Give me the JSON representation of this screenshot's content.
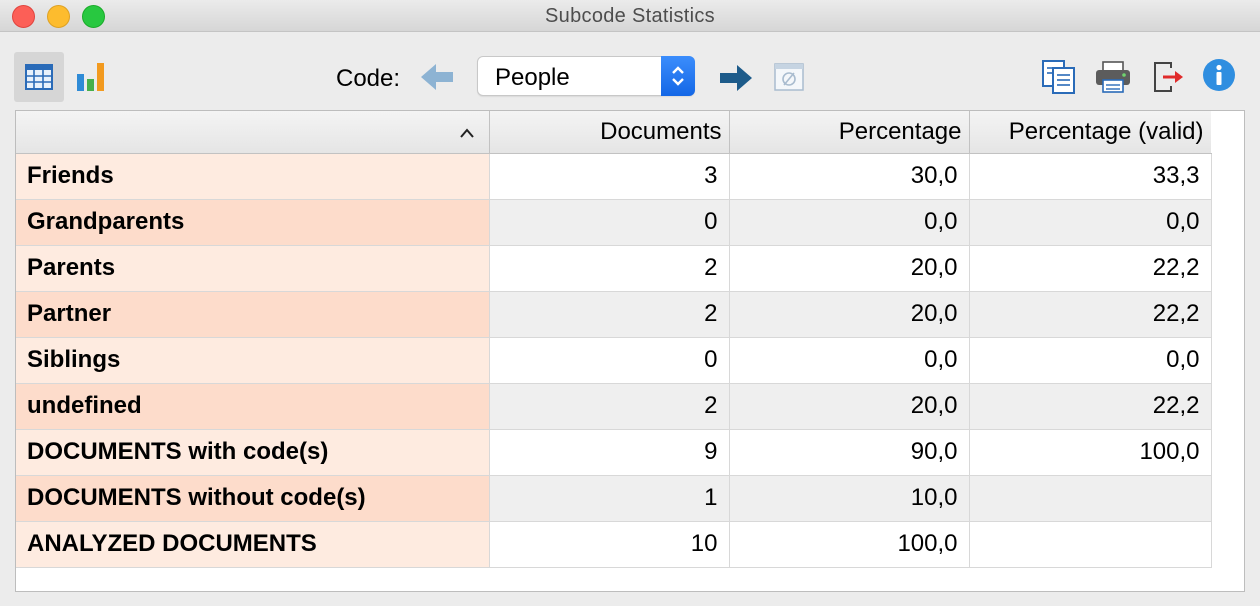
{
  "window": {
    "title": "Subcode Statistics"
  },
  "toolbar": {
    "code_label": "Code:",
    "code_value": "People",
    "icons": {
      "table_view": "table-grid-icon",
      "chart_view": "bar-chart-icon",
      "previous": "left-arrow-icon",
      "next": "right-arrow-icon",
      "reset": "null-filter-icon",
      "copy": "copy-icon",
      "print": "printer-icon",
      "export": "export-icon",
      "info": "info-icon"
    }
  },
  "table": {
    "sort_indicator": "^",
    "columns": [
      "",
      "Documents",
      "Percentage",
      "Percentage (valid)"
    ],
    "rows": [
      {
        "label": "Friends",
        "documents": "3",
        "percentage": "30,0",
        "valid": "33,3"
      },
      {
        "label": "Grandparents",
        "documents": "0",
        "percentage": "0,0",
        "valid": "0,0"
      },
      {
        "label": "Parents",
        "documents": "2",
        "percentage": "20,0",
        "valid": "22,2"
      },
      {
        "label": "Partner",
        "documents": "2",
        "percentage": "20,0",
        "valid": "22,2"
      },
      {
        "label": "Siblings",
        "documents": "0",
        "percentage": "0,0",
        "valid": "0,0"
      },
      {
        "label": "undefined",
        "documents": "2",
        "percentage": "20,0",
        "valid": "22,2"
      },
      {
        "label": "DOCUMENTS with code(s)",
        "documents": "9",
        "percentage": "90,0",
        "valid": "100,0"
      },
      {
        "label": "DOCUMENTS without code(s)",
        "documents": "1",
        "percentage": "10,0",
        "valid": ""
      },
      {
        "label": "ANALYZED DOCUMENTS",
        "documents": "10",
        "percentage": "100,0",
        "valid": ""
      }
    ]
  },
  "colors": {
    "label_odd": "#feebe0",
    "label_even": "#fddccb",
    "accent_blue": "#1467e6",
    "arrow_dark": "#1d5b8a",
    "arrow_light": "#8db3d3"
  }
}
